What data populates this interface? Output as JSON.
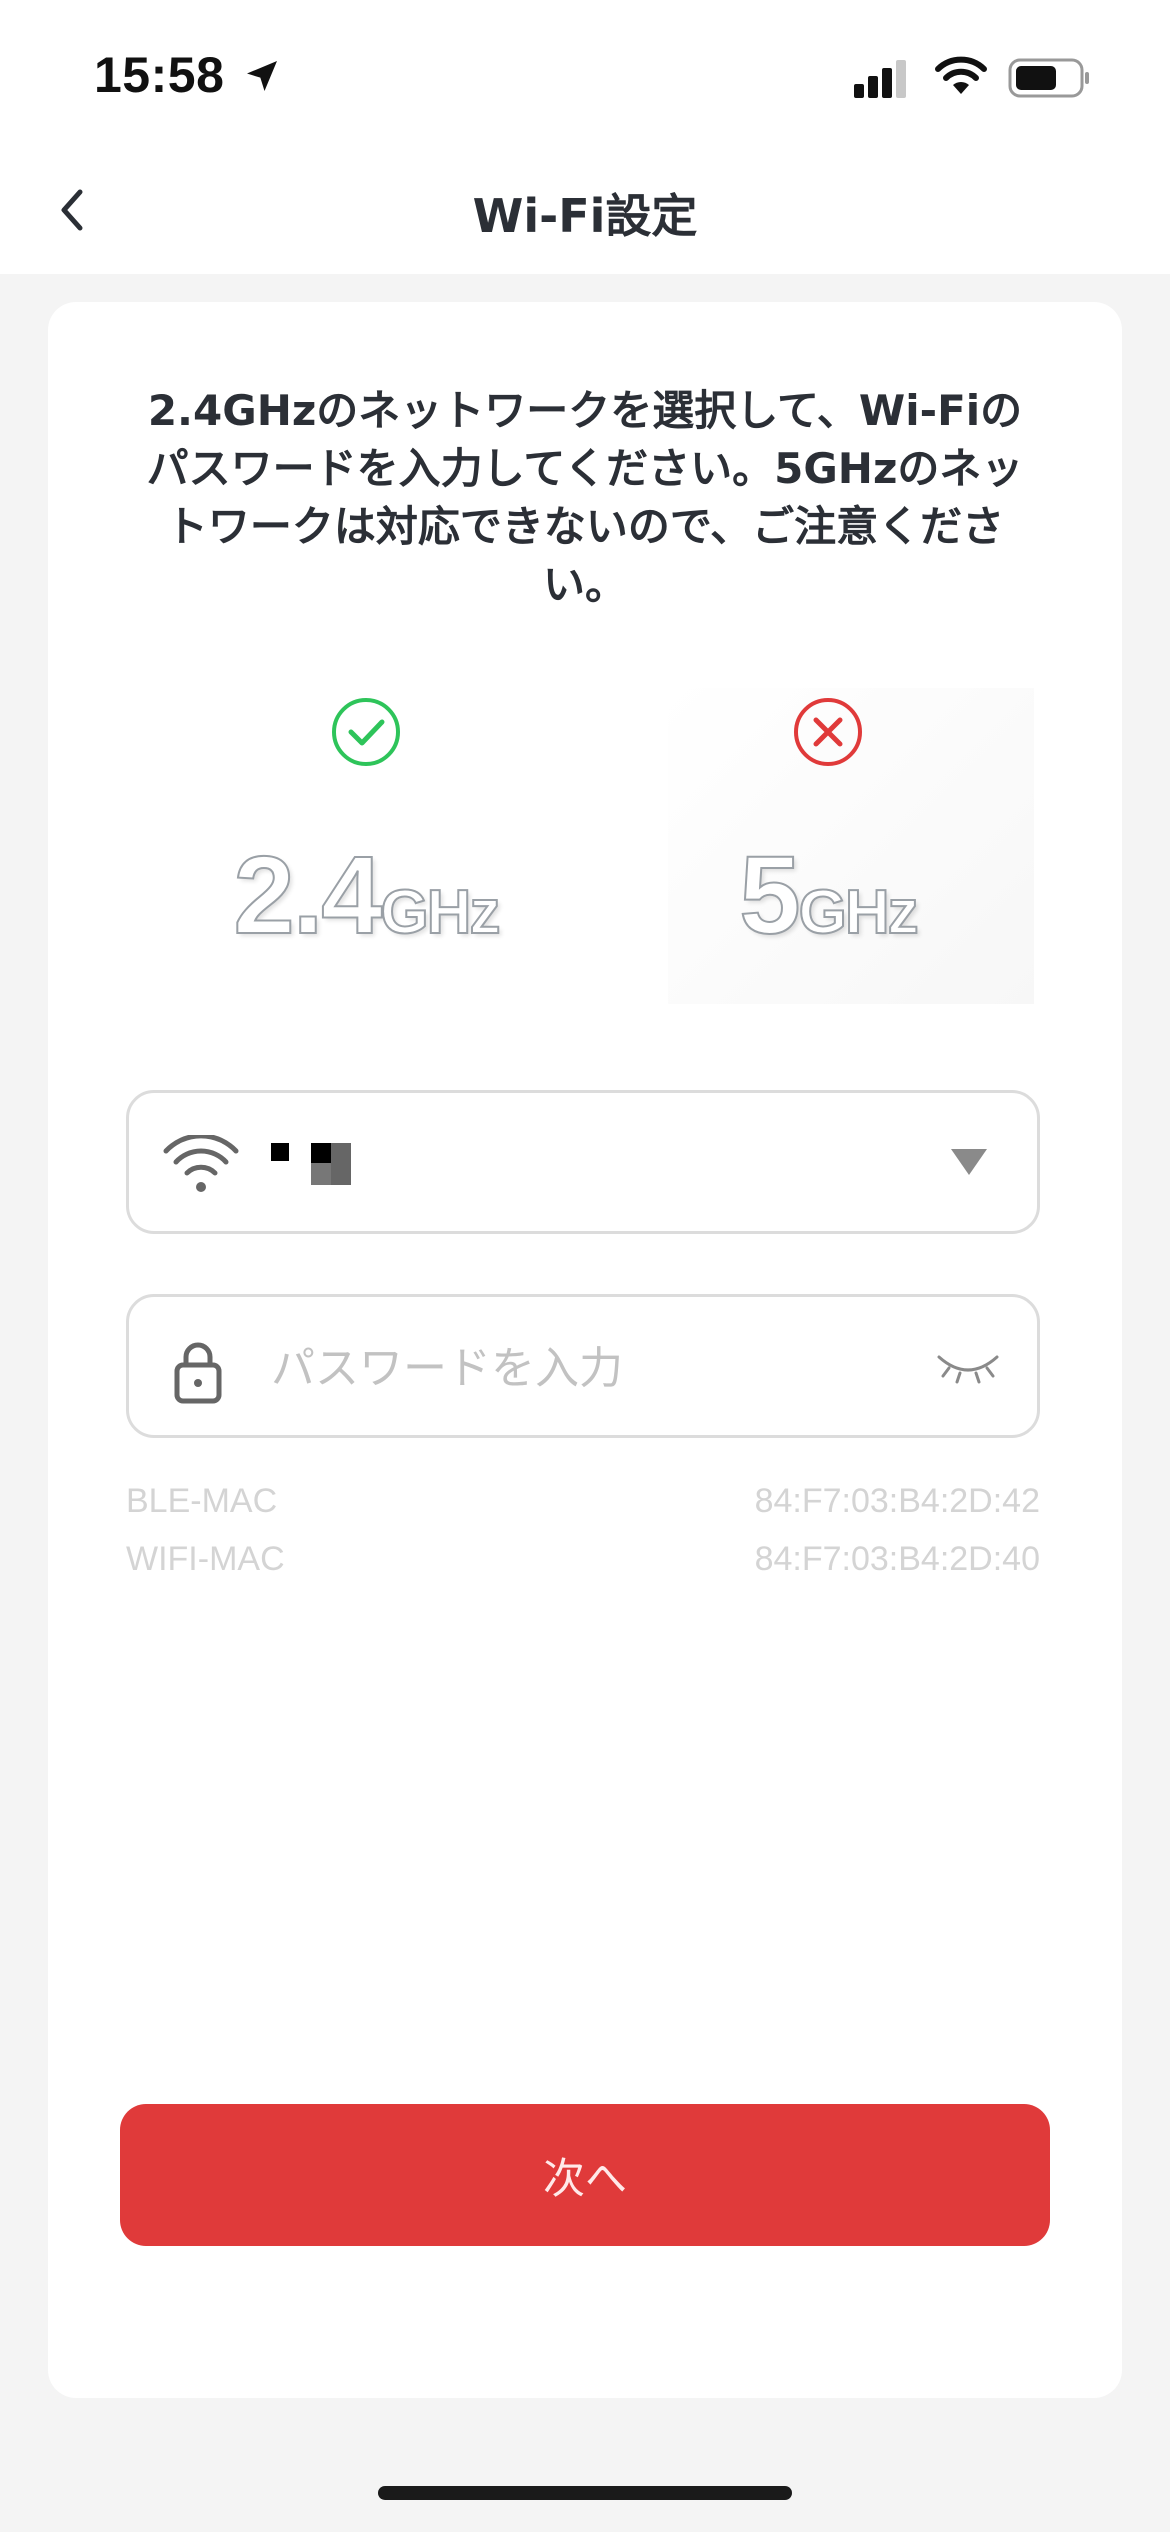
{
  "status_bar": {
    "time": "15:58",
    "icons": [
      "location-arrow-icon",
      "cellular-signal-icon",
      "wifi-icon",
      "battery-icon"
    ]
  },
  "nav": {
    "back_icon": "chevron-left-icon",
    "title": "Wi-Fi設定"
  },
  "instruction": "2.4GHzのネットワークを選択して、Wi-Fiのパスワードを入力してください。5GHzのネットワークは対応できないので、ご注意ください。",
  "bands": [
    {
      "num": "2.4",
      "unit": "GHz",
      "status": "supported",
      "icon": "check-circle-icon",
      "color": "#2ec45a"
    },
    {
      "num": "5",
      "unit": "GHz",
      "status": "unsupported",
      "icon": "x-circle-icon",
      "color": "#e03a3a"
    }
  ],
  "ssid_field": {
    "icon": "wifi-icon",
    "value_redacted": true,
    "dropdown_icon": "triangle-down-icon"
  },
  "password_field": {
    "icon": "lock-icon",
    "placeholder": "パスワードを入力",
    "value": "",
    "toggle_icon": "eye-closed-icon"
  },
  "mac_info": [
    {
      "label": "BLE-MAC",
      "value": "84:F7:03:B4:2D:42"
    },
    {
      "label": "WIFI-MAC",
      "value": "84:F7:03:B4:2D:40"
    }
  ],
  "next_button": {
    "label": "次へ"
  },
  "colors": {
    "accent": "#e03a3a",
    "success": "#2ec45a",
    "page_bg": "#f4f4f4",
    "card_bg": "#ffffff"
  }
}
